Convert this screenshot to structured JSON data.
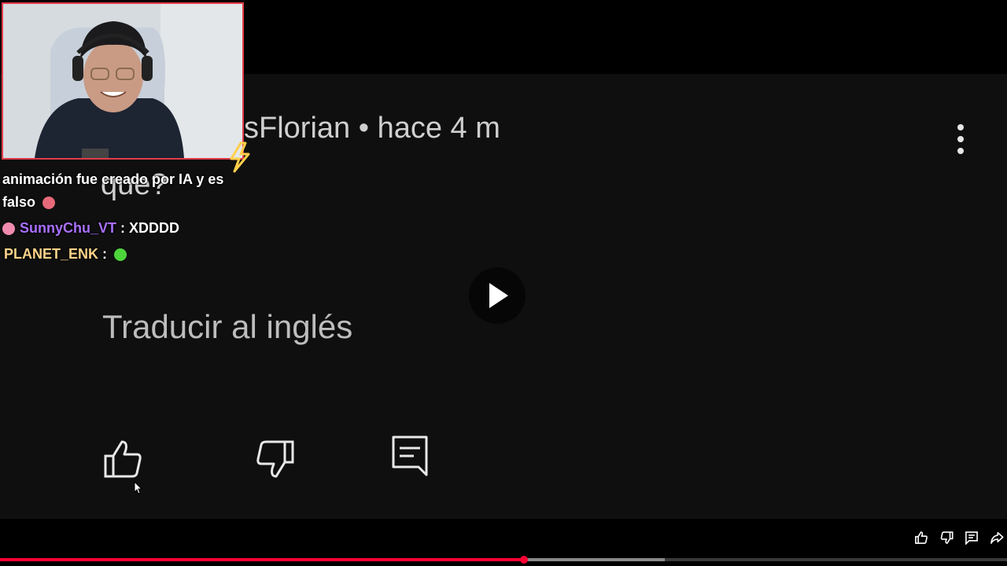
{
  "comment": {
    "author_time": "sFlorian • hace 4 m",
    "text_partial": "que?",
    "translate_label": "Traducir al inglés"
  },
  "chat": {
    "messages": [
      {
        "text": "animación fue creado por IA y es"
      },
      {
        "text": "falso"
      },
      {
        "user": "SunnyChu_VT",
        "sep": " : ",
        "text": "XDDDD"
      },
      {
        "user": "PLANET_ENK",
        "sep": " :",
        "text": ""
      }
    ]
  },
  "player": {
    "progress_played": 0.52,
    "progress_loaded": 0.66
  },
  "colors": {
    "accent": "#ff0033",
    "webcam_border": "#e23b4a",
    "chat_purple": "#a970ff",
    "chat_gold": "#ffd48a"
  },
  "icons": [
    "play-icon",
    "kebab-menu-icon",
    "thumbs-up-icon",
    "thumbs-down-icon",
    "comment-icon",
    "share-icon",
    "cursor-icon",
    "lightning-icon"
  ]
}
